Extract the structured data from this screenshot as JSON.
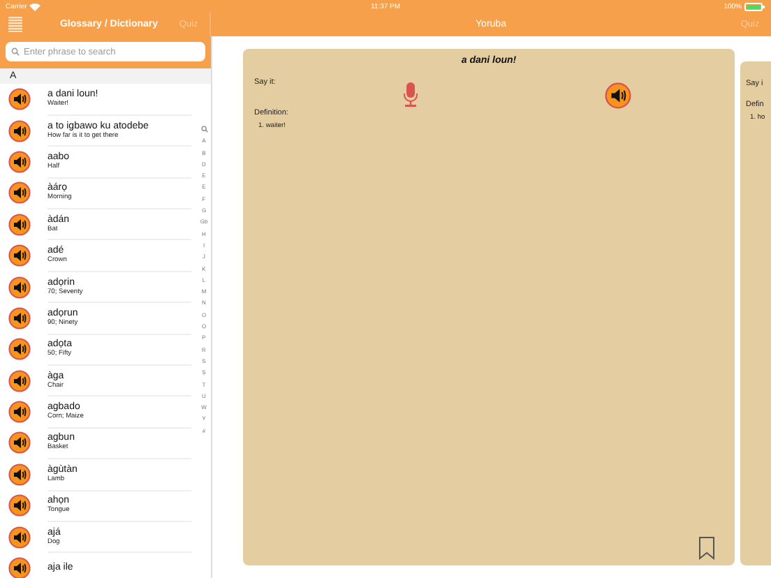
{
  "status_bar": {
    "carrier": "Carrier",
    "time": "11:37 PM",
    "battery": "100%"
  },
  "sidebar": {
    "title": "Glossary / Dictionary",
    "quiz_button": "Quiz",
    "search": {
      "placeholder": "Enter phrase to search"
    },
    "section": "A",
    "entries": [
      {
        "word": "a dani loun!",
        "meaning": "Waiter!"
      },
      {
        "word": "a to igbawo ku atodebe",
        "meaning": "How far is it to get there"
      },
      {
        "word": "aabo",
        "meaning": "Half"
      },
      {
        "word": "àárọ",
        "meaning": "Morning"
      },
      {
        "word": "àdán",
        "meaning": "Bat"
      },
      {
        "word": "adé",
        "meaning": "Crown"
      },
      {
        "word": "adọrin",
        "meaning": "70; Seventy"
      },
      {
        "word": "adọrun",
        "meaning": "90; Ninety"
      },
      {
        "word": "adọta",
        "meaning": "50; Fifty"
      },
      {
        "word": "àga",
        "meaning": "Chair"
      },
      {
        "word": "agbado",
        "meaning": "Corn; Maize"
      },
      {
        "word": "agbun",
        "meaning": "Basket"
      },
      {
        "word": "àgùtàn",
        "meaning": "Lamb"
      },
      {
        "word": "ahọn",
        "meaning": "Tongue"
      },
      {
        "word": "ajá",
        "meaning": "Dog"
      },
      {
        "word": "aja ile"
      }
    ],
    "index": [
      "A",
      "B",
      "D",
      "E",
      "Ẹ",
      "F",
      "G",
      "Gb",
      "H",
      "I",
      "J",
      "K",
      "L",
      "M",
      "N",
      "O",
      "Ọ",
      "P",
      "R",
      "S",
      "Ṣ",
      "T",
      "U",
      "W",
      "Y",
      "#"
    ]
  },
  "detail": {
    "title": "Yoruba",
    "quiz_button": "Quiz",
    "card": {
      "phrase": "a dani loun!",
      "say_label": "Say it:",
      "definition_label": "Definition:",
      "definitions": [
        "1. waiter!"
      ]
    },
    "next_card": {
      "say_label": "Say i",
      "definition_label": "Defin",
      "definitions": [
        "1. ho"
      ]
    }
  }
}
